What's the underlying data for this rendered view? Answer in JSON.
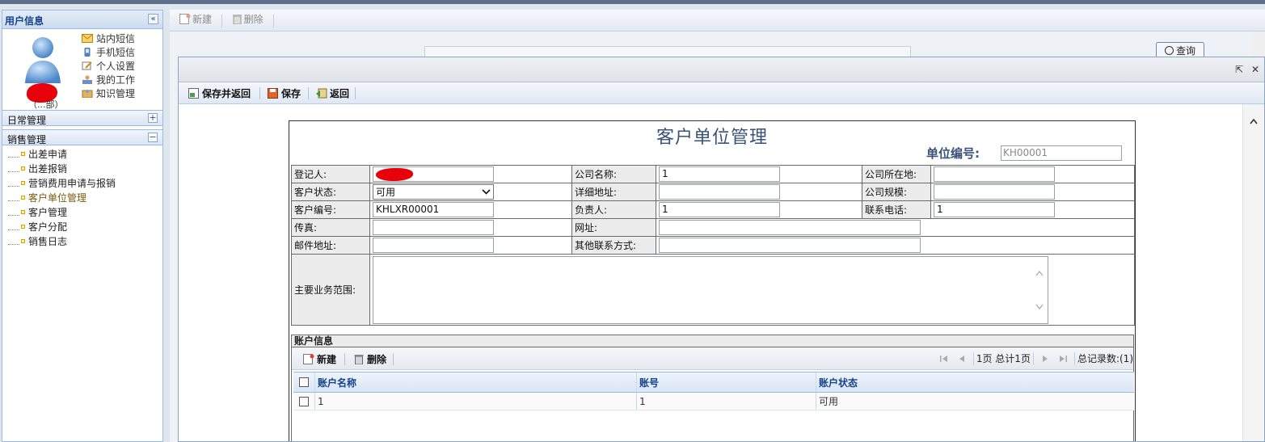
{
  "sidebar": {
    "user_panel_title": "用户信息",
    "department": "（...部）",
    "user_links": [
      {
        "label": "站内短信",
        "icon": "envelope-icon"
      },
      {
        "label": "手机短信",
        "icon": "mobile-phone-icon"
      },
      {
        "label": "个人设置",
        "icon": "edit-settings-icon"
      },
      {
        "label": "我的工作",
        "icon": "user-work-icon"
      },
      {
        "label": "知识管理",
        "icon": "knowledge-icon"
      }
    ],
    "accordion": [
      {
        "label": "日常管理",
        "state": "+"
      },
      {
        "label": "销售管理",
        "state": "−"
      }
    ],
    "tree_items": [
      "出差申请",
      "出差报销",
      "营销费用申请与报销",
      "客户单位管理",
      "客户管理",
      "客户分配",
      "销售日志"
    ]
  },
  "background_toolbar": {
    "new_label": "新建",
    "delete_label": "删除",
    "query_label": "查询"
  },
  "modal": {
    "toolbar": {
      "save_return_label": "保存并返回",
      "save_label": "保存",
      "back_label": "返回"
    },
    "form": {
      "title": "客户单位管理",
      "unit_no_label": "单位编号:",
      "unit_no_value": "KH00001",
      "labels": {
        "registrar": "登记人:",
        "company_name": "公司名称:",
        "company_location": "公司所在地:",
        "customer_status": "客户状态:",
        "address": "详细地址:",
        "company_scale": "公司规模:",
        "customer_no": "客户编号:",
        "principal": "负责人:",
        "phone": "联系电话:",
        "fax": "传真:",
        "website": "网址:",
        "email": "邮件地址:",
        "other_contact": "其他联系方式:",
        "business_scope": "主要业务范围:"
      },
      "values": {
        "company_name": "1",
        "company_location": "",
        "customer_status": "可用",
        "address": "",
        "company_scale": "",
        "customer_no": "KHLXR00001",
        "principal": "1",
        "phone": "1",
        "fax": "",
        "website": "",
        "email": "",
        "other_contact": "",
        "business_scope": ""
      }
    },
    "accounts": {
      "section_title": "账户信息",
      "new_label": "新建",
      "delete_label": "删除",
      "pager_text": "1页 总计1页",
      "total_text": "总记录数:(1)",
      "columns": [
        "账户名称",
        "账号",
        "账户状态"
      ],
      "rows": [
        {
          "name": "1",
          "account": "1",
          "status": "可用"
        }
      ]
    }
  },
  "colors": {
    "accent": "#15428b",
    "title": "#3a5178",
    "redaction": "#e8000a"
  }
}
